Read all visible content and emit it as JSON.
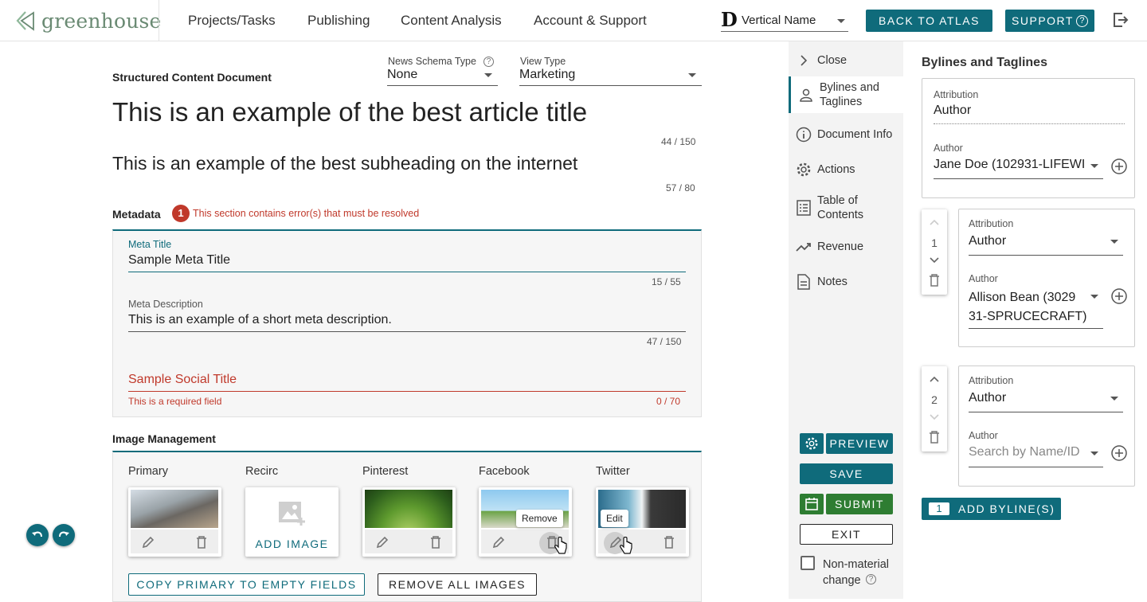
{
  "brand": {
    "name": "greenhouse",
    "accent": "#0f6b7b",
    "error": "#c0392b"
  },
  "nav": {
    "items": [
      "Projects/Tasks",
      "Publishing",
      "Content Analysis",
      "Account & Support"
    ]
  },
  "vertical_select": {
    "logo_letter": "D",
    "value": "Vertical Name"
  },
  "header_buttons": {
    "back": "BACK TO ATLAS",
    "support": "SUPPORT",
    "logout_icon": "logout-icon"
  },
  "doc": {
    "label": "Structured Content Document",
    "news_schema": {
      "label": "News Schema Type",
      "value": "None"
    },
    "view_type": {
      "label": "View Type",
      "value": "Marketing"
    },
    "title": "This is an example of the best article title",
    "title_count": "44 / 150",
    "subheading": "This is an example of the best subheading on the internet",
    "subheading_count": "57 / 80"
  },
  "metadata": {
    "heading": "Metadata",
    "error_count": "1",
    "error_msg": "This section contains error(s) that must be resolved",
    "meta_title": {
      "label": "Meta Title",
      "value": "Sample Meta Title",
      "count": "15 / 55"
    },
    "meta_desc": {
      "label": "Meta Description",
      "value": "This is an example of a short meta description.",
      "count": "47 / 150"
    },
    "social_title": {
      "placeholder": "Sample Social Title",
      "error": "This is a required field",
      "count": "0 / 70"
    }
  },
  "images": {
    "heading": "Image Management",
    "slots": [
      "Primary",
      "Recirc",
      "Pinterest",
      "Facebook",
      "Twitter"
    ],
    "add_image": "ADD IMAGE",
    "tip_remove": "Remove",
    "tip_edit": "Edit",
    "copy_btn": "COPY PRIMARY TO EMPTY FIELDS",
    "remove_all_btn": "REMOVE ALL IMAGES"
  },
  "sidebar": {
    "close": "Close",
    "items": [
      "Bylines and\nTaglines",
      "Document Info",
      "Actions",
      "Table of\nContents",
      "Revenue",
      "Notes"
    ],
    "preview": "PREVIEW",
    "save": "SAVE",
    "submit": "SUBMIT",
    "exit": "EXIT",
    "non_material": "Non-material change"
  },
  "bylines": {
    "heading": "Bylines and Taglines",
    "attribution_label": "Attribution",
    "author_label": "Author",
    "first": {
      "attribution": "Author",
      "author": "Jane Doe (102931-LIFEWI"
    },
    "second": {
      "order": "1",
      "attribution": "Author",
      "author_line1": "Allison Bean (3029",
      "author_line2": "31-SPRUCECRAFT)"
    },
    "third": {
      "order": "2",
      "attribution": "Author",
      "author_placeholder": "Search by Name/ID"
    },
    "add_count": "1",
    "add_label": "ADD BYLINE(S)"
  }
}
